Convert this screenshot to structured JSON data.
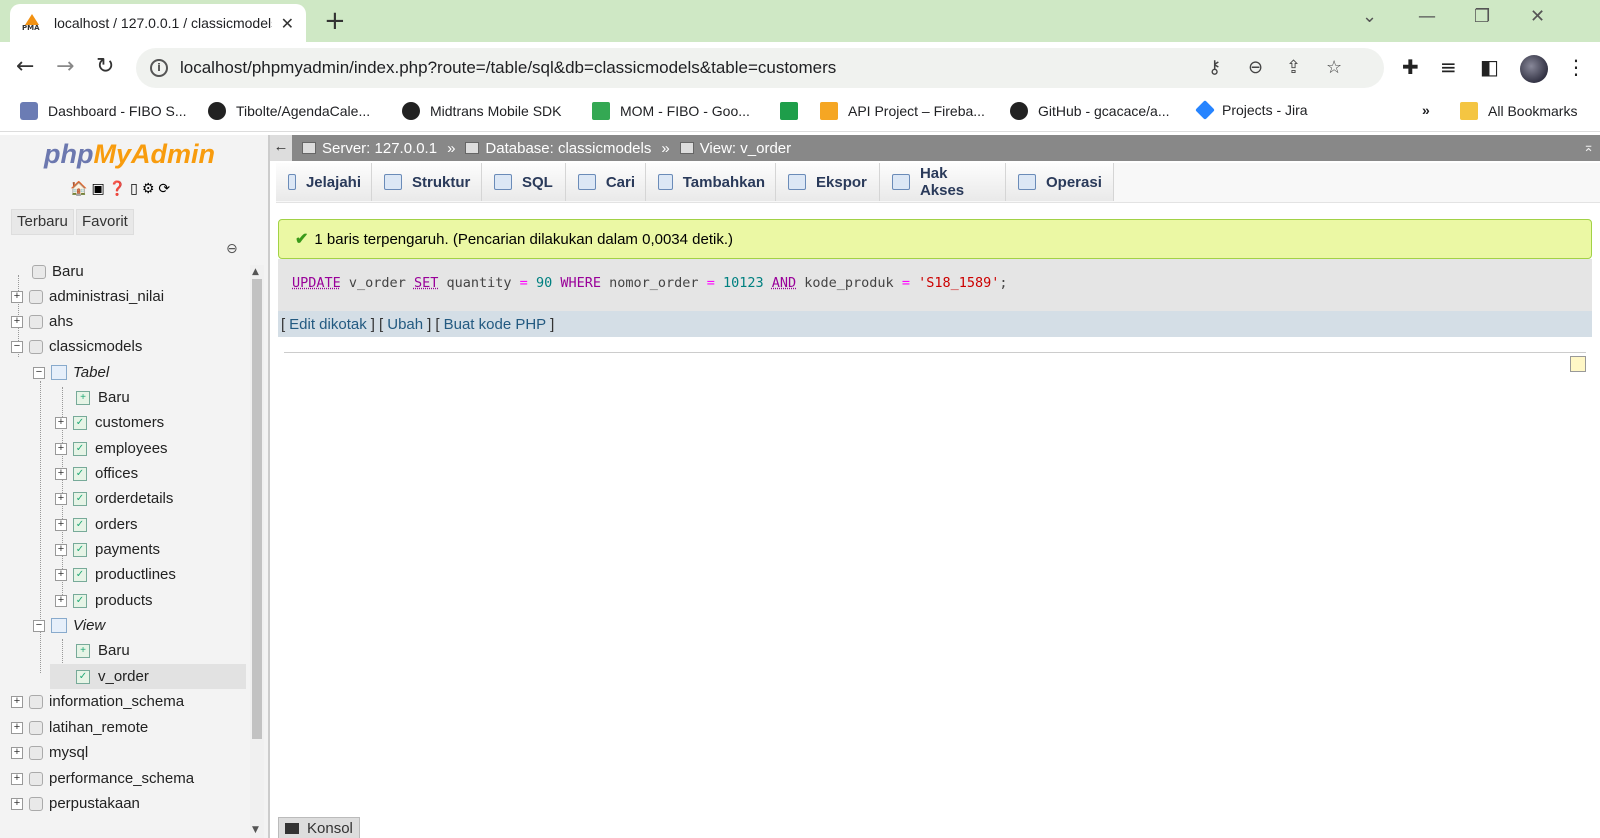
{
  "browser": {
    "tab_title": "localhost / 127.0.0.1 / classicmodels",
    "url": "localhost/phpmyadmin/index.php?route=/table/sql&db=classicmodels&table=customers",
    "favicon_text": "PMA",
    "bookmarks": [
      "Dashboard - FIBO S...",
      "Tibolte/AgendaCale...",
      "Midtrans Mobile SDK",
      "MOM - FIBO - Goo...",
      "",
      "API Project – Fireba...",
      "GitHub - gcacace/a...",
      "Projects - Jira"
    ],
    "bookmarks_more": "»",
    "all_bookmarks": "All Bookmarks"
  },
  "nav": {
    "logo_php": "php",
    "logo_my": "MyAdmin",
    "tab_recent": "Terbaru",
    "tab_favorite": "Favorit",
    "tree": {
      "new": "Baru",
      "db1": "administrasi_nilai",
      "db2": "ahs",
      "db3": "classicmodels",
      "tables_group": "Tabel",
      "tables_new": "Baru",
      "tables": [
        "customers",
        "employees",
        "offices",
        "orderdetails",
        "orders",
        "payments",
        "productlines",
        "products"
      ],
      "views_group": "View",
      "views_new": "Baru",
      "view1": "v_order",
      "db4": "information_schema",
      "db5": "latihan_remote",
      "db6": "mysql",
      "db7": "performance_schema",
      "db8": "perpustakaan"
    }
  },
  "breadcrumb": {
    "server": "Server: 127.0.0.1",
    "database": "Database: classicmodels",
    "view": "View: v_order",
    "sep": "»"
  },
  "menu": [
    "Jelajahi",
    "Struktur",
    "SQL",
    "Cari",
    "Tambahkan",
    "Ekspor",
    "Hak Akses",
    "Operasi"
  ],
  "result": {
    "message": "1 baris terpengaruh. (Pencarian dilakukan dalam 0,0034 detik.)",
    "sql": {
      "kw_update": "UPDATE",
      "table": "v_order",
      "kw_set": "SET",
      "col1": "quantity",
      "eq": "=",
      "val1": "90",
      "kw_where": "WHERE",
      "col2": "nomor_order",
      "val2": "10123",
      "kw_and": "AND",
      "col3": "kode_produk",
      "val3": "'S18_1589'",
      "end": ";"
    },
    "links": {
      "edit_inline": "Edit dikotak",
      "edit": "Ubah",
      "php_code": "Buat kode PHP"
    }
  },
  "console": "Konsol"
}
